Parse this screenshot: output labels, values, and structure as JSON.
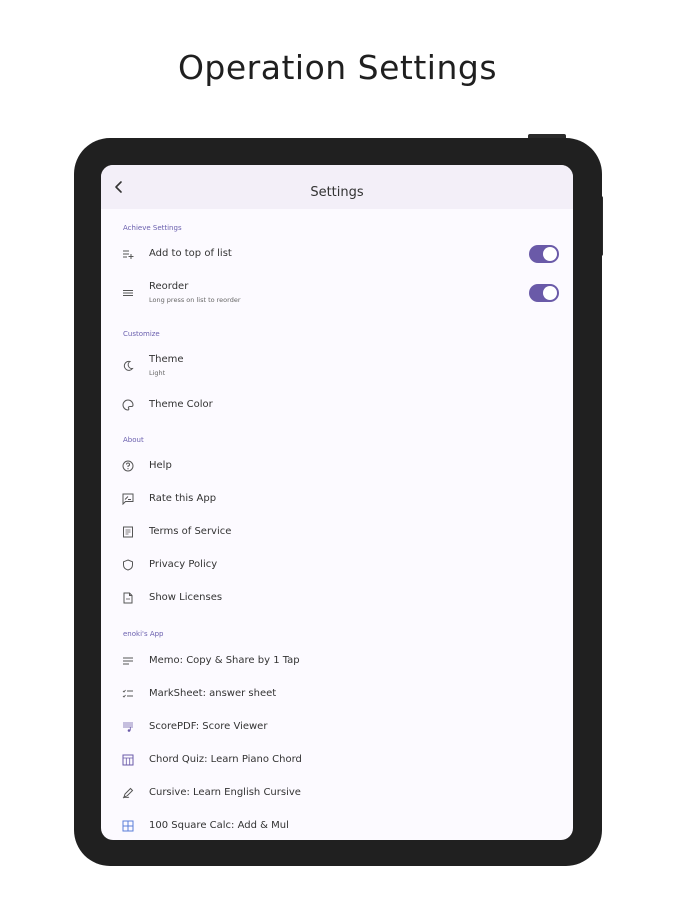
{
  "headline": "Operation Settings",
  "appbar": {
    "title": "Settings"
  },
  "sections": {
    "achieve": {
      "header": "Achieve Settings",
      "add_top": {
        "title": "Add to top of list",
        "enabled": true
      },
      "reorder": {
        "title": "Reorder",
        "subtitle": "Long press on list to reorder",
        "enabled": true
      }
    },
    "customize": {
      "header": "Customize",
      "theme": {
        "title": "Theme",
        "subtitle": "Light"
      },
      "theme_color": {
        "title": "Theme Color"
      }
    },
    "about": {
      "header": "About",
      "help": "Help",
      "rate": "Rate this App",
      "terms": "Terms of Service",
      "privacy": "Privacy Policy",
      "licenses": "Show Licenses"
    },
    "apps": {
      "header": "enoki's App",
      "memo": "Memo: Copy & Share by 1 Tap",
      "marksheet": "MarkSheet: answer sheet",
      "scorepdf": "ScorePDF: Score Viewer",
      "chordquiz": "Chord Quiz: Learn Piano Chord",
      "cursive": "Cursive: Learn English Cursive",
      "square": "100 Square Calc: Add & Mul"
    }
  },
  "colors": {
    "accent": "#6a5aa8",
    "screen_bg": "#fcfaff",
    "appbar_bg": "#f3eff8",
    "device": "#202020"
  },
  "icons": {
    "back": "chevron-left-icon",
    "add_top": "playlist-add-icon",
    "reorder": "reorder-icon",
    "theme": "moon-icon",
    "theme_color": "palette-icon",
    "help": "help-circle-icon",
    "rate": "rate-review-icon",
    "terms": "document-icon",
    "privacy": "shield-icon",
    "licenses": "file-icon",
    "memo": "notes-icon",
    "marksheet": "checklist-icon",
    "scorepdf": "music-score-icon",
    "chordquiz": "piano-icon",
    "cursive": "pen-icon",
    "square": "grid-icon"
  }
}
